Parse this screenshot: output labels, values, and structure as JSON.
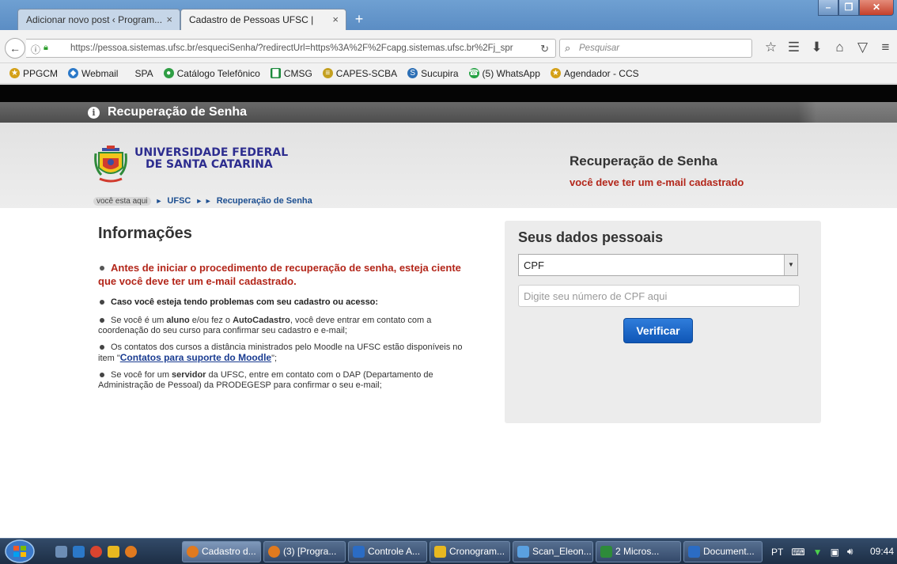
{
  "browser": {
    "tabs": [
      {
        "label": "Adicionar novo post ‹ Program...",
        "close": "×"
      },
      {
        "label": "Cadastro de Pessoas UFSC |",
        "close": "×"
      }
    ],
    "new_tab": "+",
    "window_buttons": {
      "minimize": "–",
      "maximize": "❐",
      "close": "✕"
    },
    "url": "https://pessoa.sistemas.ufsc.br/esqueciSenha/?redirectUrl=https%3A%2F%2Fcapg.sistemas.ufsc.br%2Fj_spr",
    "search_placeholder": "Pesquisar",
    "bookmarks": [
      {
        "label": "PPGCM",
        "icon": "person-icon",
        "color": "#d4a017"
      },
      {
        "label": "Webmail",
        "icon": "webmail-icon",
        "color": "#2b78c8"
      },
      {
        "label": "SPA",
        "icon": "",
        "color": ""
      },
      {
        "label": "Catálogo Telefônico",
        "icon": "globe-icon",
        "color": "#2f9e44"
      },
      {
        "label": "CMSG",
        "icon": "chart-icon",
        "color": "#1c8a3c"
      },
      {
        "label": "CAPES-SCBA",
        "icon": "capes-icon",
        "color": "#c4a020"
      },
      {
        "label": "Sucupira",
        "icon": "sucupira-icon",
        "color": "#2c6fb5"
      },
      {
        "label": "(5) WhatsApp",
        "icon": "whatsapp-icon",
        "color": "#25a244"
      },
      {
        "label": "Agendador - CCS",
        "icon": "person-icon",
        "color": "#d4a017"
      }
    ]
  },
  "page": {
    "title_bar": "Recuperação de Senha",
    "university_line1": "UNIVERSIDADE FEDERAL",
    "university_line2": "DE SANTA CATARINA",
    "header_title": "Recuperação de Senha",
    "header_subtitle": "você deve ter um e-mail cadastrado",
    "breadcrumb": {
      "here": "você esta aqui",
      "sep1": "►",
      "link1": "UFSC",
      "sep2": "► ►",
      "link2": "Recuperação de Senha"
    },
    "info": {
      "heading": "Informações",
      "warning": "Antes de iniciar o procedimento de recuperação de senha, esteja ciente que você deve ter um e-mail cadastrado.",
      "problems": "Caso você esteja tendo problemas com seu cadastro ou acesso:",
      "aluno_pre": "Se você é um ",
      "aluno_bold": "aluno",
      "aluno_mid": " e/ou fez o ",
      "aluno_bold2": "AutoCadastro",
      "aluno_post": ", você deve entrar em contato com a coordenação do seu curso para confirmar seu cadastro e e-mail;",
      "moodle_pre": "Os contatos dos cursos a distância ministrados pelo Moodle na UFSC estão disponíveis no item \"",
      "moodle_link": "Contatos para suporte do Moodle",
      "moodle_post": "\";",
      "servidor_pre": "Se você for um ",
      "servidor_bold": "servidor",
      "servidor_post": " da UFSC, entre em contato com o DAP (Departamento de Administração de Pessoal) da PRODEGESP para confirmar o seu e-mail;"
    },
    "form": {
      "title": "Seus dados pessoais",
      "select_value": "CPF",
      "input_placeholder": "Digite seu número de CPF aqui",
      "input_value": "",
      "button": "Verificar"
    }
  },
  "taskbar": {
    "tasks": [
      {
        "label": "Cadastro d...",
        "color": "#e07a1f",
        "active": true
      },
      {
        "label": "(3) [Progra...",
        "color": "#e07a1f",
        "active": false
      },
      {
        "label": "Controle A...",
        "color": "#2b6cc4",
        "active": false
      },
      {
        "label": "Cronogram...",
        "color": "#e8b820",
        "active": false
      },
      {
        "label": "Scan_Eleon...",
        "color": "#5aa0e0",
        "active": false
      },
      {
        "label": "2 Micros...",
        "color": "#2e8b3a",
        "active": false
      },
      {
        "label": "Document...",
        "color": "#2b6cc4",
        "active": false
      }
    ],
    "language": "PT",
    "clock": "09:44"
  }
}
